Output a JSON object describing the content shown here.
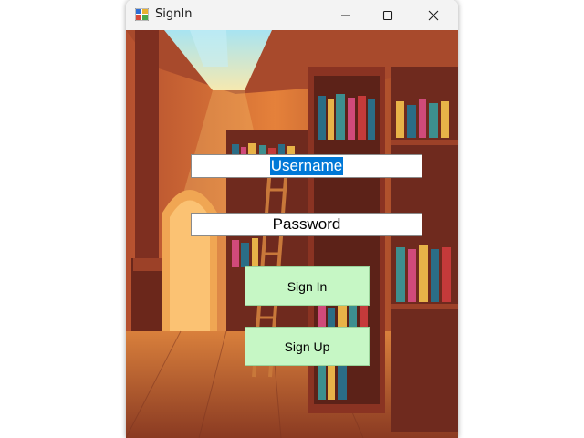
{
  "window": {
    "title": "SignIn",
    "icon": "winforms-app-icon"
  },
  "form": {
    "username": {
      "value": "Username",
      "selected": true
    },
    "password": {
      "value": "Password"
    },
    "signin_label": "Sign In",
    "signup_label": "Sign Up"
  },
  "colors": {
    "button_bg": "#c6f7c5",
    "selection": "#0078d7",
    "titlebar": "#f3f3f3"
  },
  "background": "library-illustration"
}
